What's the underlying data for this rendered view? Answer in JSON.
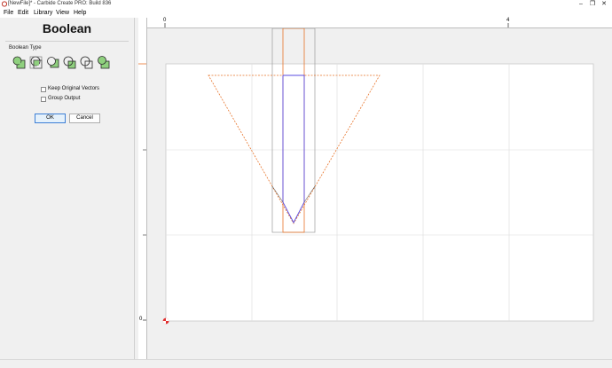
{
  "window": {
    "title": "[NewFile]* - Carbide Create PRO: Build 836",
    "minimize_icon": "minimize-icon",
    "maximize_icon": "restore-icon",
    "close_icon": "close-icon"
  },
  "menu": {
    "items": [
      "File",
      "Edit",
      "Library",
      "View",
      "Help"
    ]
  },
  "panel": {
    "title": "Boolean",
    "boolean_type_label": "Boolean Type",
    "boolean_type_icons": [
      "union-icon",
      "intersect-icon",
      "subtract-icon",
      "subtract-reverse-icon",
      "exclusive-or-icon",
      "weld-icon"
    ],
    "keep_original_label": "Keep Original Vectors",
    "keep_original_checked": false,
    "group_output_label": "Group Output",
    "group_output_checked": false,
    "ok_label": "OK",
    "cancel_label": "Cancel"
  },
  "rulers": {
    "top_labels": [
      "0",
      "4"
    ],
    "left_labels": [
      "0"
    ]
  },
  "colors": {
    "accent": "#3c7fd6",
    "shape_orange": "#e8742a",
    "shape_blue": "#5a4be0",
    "selection_gray": "#9a9a9a",
    "grid": "#dcdcdc",
    "ruler_marker": "#e0502a"
  }
}
